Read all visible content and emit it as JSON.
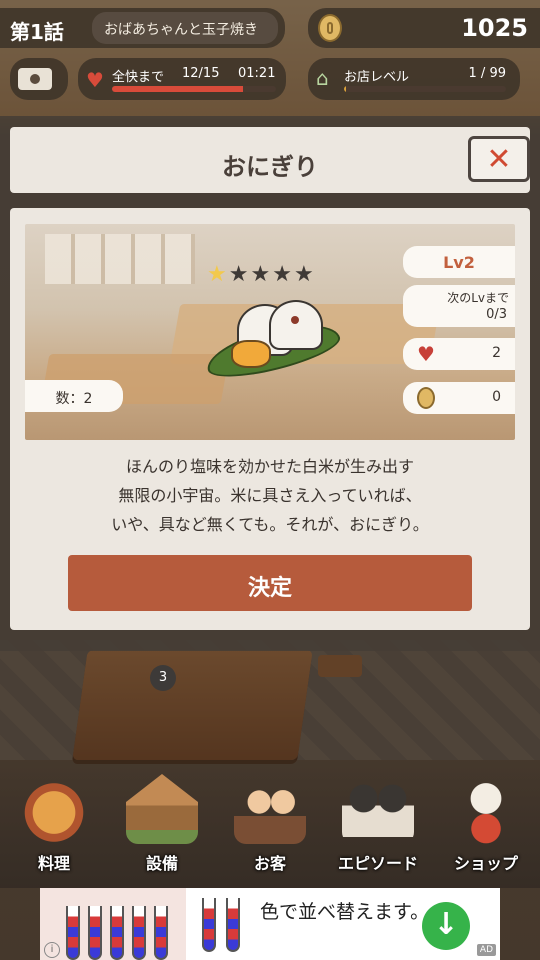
{
  "hud": {
    "episode_number": "第1話",
    "episode_title": "おばあちゃんと玉子焼き",
    "coins": "1025",
    "mood_label": "全快まで",
    "mood_count": "12/15",
    "mood_timer": "01:21",
    "mood_progress": 0.8,
    "shop_level_label": "お店レベル",
    "shop_level_count": "1 / 99",
    "shop_level_progress": 0.01
  },
  "modal": {
    "title": "おにぎり",
    "close_icon": "close-x",
    "rating": {
      "filled": 1,
      "total": 5
    },
    "level": "Lv2",
    "next_level_label": "次のLvまで",
    "next_level_value": "0/3",
    "hearts": "2",
    "coins": "0",
    "quantity": "数：2",
    "description": [
      "ほんのり塩味を効かせた白米が生み出す",
      "無限の小宇宙。米に具さえ入っていれば、",
      "いや、具など無くても。それが、おにぎり。"
    ],
    "confirm_label": "決定"
  },
  "scene": {
    "bubble_badge": "3"
  },
  "nav": {
    "items": [
      {
        "label": "料理",
        "icon": "cooking-pot-icon"
      },
      {
        "label": "設備",
        "icon": "building-icon"
      },
      {
        "label": "お客",
        "icon": "customers-icon"
      },
      {
        "label": "エピソード",
        "icon": "film-camera-icon"
      },
      {
        "label": "ショップ",
        "icon": "lucky-cat-icon"
      }
    ]
  },
  "ad": {
    "text": "色で並べ替えます。",
    "download_icon": "download-arrow-icon",
    "ad_label": "AD"
  },
  "colors": {
    "accent": "#b65b3c",
    "panel": "#ece7e0",
    "heart": "#c74038",
    "star": "#f2c94c"
  }
}
